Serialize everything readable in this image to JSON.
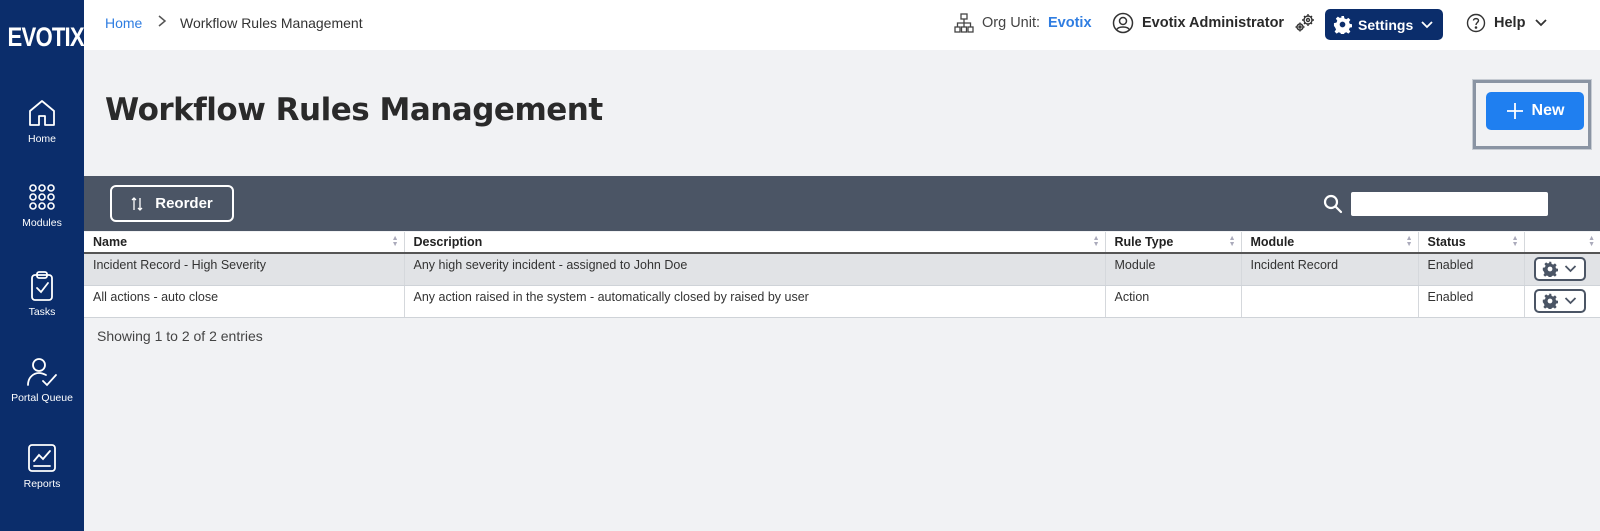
{
  "app": {
    "logo": "EVOTIX"
  },
  "sidebar": {
    "items": [
      {
        "label": "Home",
        "icon": "home-icon"
      },
      {
        "label": "Modules",
        "icon": "modules-grid-icon"
      },
      {
        "label": "Tasks",
        "icon": "clipboard-check-icon"
      },
      {
        "label": "Portal Queue",
        "icon": "person-check-icon"
      },
      {
        "label": "Reports",
        "icon": "report-chart-icon"
      }
    ]
  },
  "header": {
    "breadcrumb": {
      "home": "Home",
      "separator": ">",
      "current": "Workflow Rules Management"
    },
    "org_unit_label": "Org Unit:",
    "org_unit_value": "Evotix",
    "user_name": "Evotix Administrator",
    "settings_label": "Settings",
    "help_label": "Help"
  },
  "page": {
    "title": "Workflow Rules Management",
    "new_label": "New"
  },
  "toolbar": {
    "reorder_label": "Reorder",
    "search_placeholder": ""
  },
  "table": {
    "columns": [
      "Name",
      "Description",
      "Rule Type",
      "Module",
      "Status",
      ""
    ],
    "rows": [
      {
        "name": "Incident Record - High Severity",
        "description": "Any high severity incident - assigned to John Doe",
        "rule_type": "Module",
        "module": "Incident Record",
        "status": "Enabled"
      },
      {
        "name": "All actions - auto close",
        "description": "Any action raised in the system - automatically closed by raised by user",
        "rule_type": "Action",
        "module": "",
        "status": "Enabled"
      }
    ]
  },
  "footer": {
    "entries_text": "Showing 1 to 2 of 2 entries"
  },
  "colors": {
    "sidebar": "#0b2d6b",
    "accent": "#1f7ff0",
    "link": "#2f7de1",
    "toolbar": "#4b5565"
  }
}
